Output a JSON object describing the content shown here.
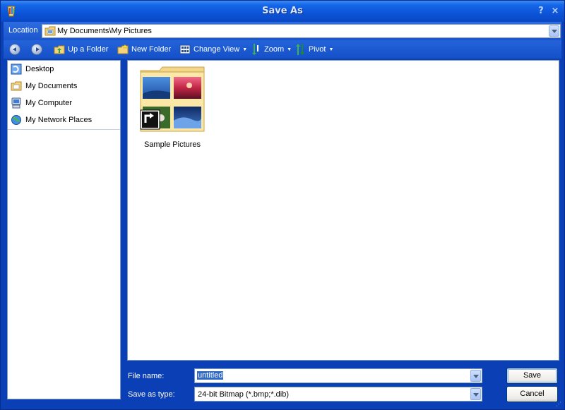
{
  "window": {
    "title": "Save As",
    "help_label": "?",
    "close_label": "×"
  },
  "location": {
    "label": "Location",
    "value": "My Documents\\My Pictures"
  },
  "toolbar": {
    "up_folder": "Up a Folder",
    "new_folder": "New Folder",
    "change_view": "Change View",
    "zoom": "Zoom",
    "pivot": "Pivot"
  },
  "places": [
    {
      "label": "Desktop",
      "icon": "desktop-icon"
    },
    {
      "label": "My Documents",
      "icon": "documents-icon"
    },
    {
      "label": "My Computer",
      "icon": "computer-icon"
    },
    {
      "label": "My Network Places",
      "icon": "network-icon"
    }
  ],
  "files": [
    {
      "label": "Sample Pictures",
      "icon": "folder-shortcut-icon"
    }
  ],
  "form": {
    "file_name_label": "File name:",
    "file_name_value": "untitled",
    "save_type_label": "Save as type:",
    "save_type_value": "24-bit Bitmap (*.bmp;*.dib)"
  },
  "buttons": {
    "save": "Save",
    "cancel": "Cancel"
  },
  "colors": {
    "titlebar": "#0c54d8",
    "frame": "#0b3fb5",
    "selection": "#316ac5"
  }
}
